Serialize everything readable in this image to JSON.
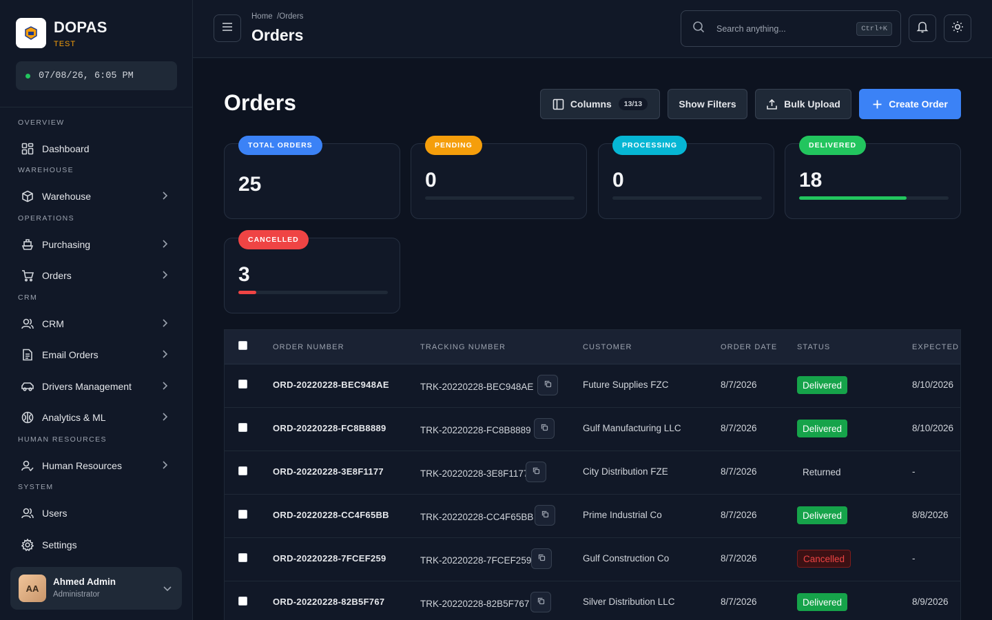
{
  "brand": {
    "name": "DOPAS",
    "env": "TEST"
  },
  "clock": "07/08/26, 6:05 PM",
  "sidebar": {
    "sections": [
      {
        "label": "OVERVIEW",
        "items": [
          {
            "label": "Dashboard",
            "icon": "dashboard-icon",
            "chevron": false
          }
        ]
      },
      {
        "label": "WAREHOUSE",
        "items": [
          {
            "label": "Warehouse",
            "icon": "box-icon",
            "chevron": true
          }
        ]
      },
      {
        "label": "OPERATIONS",
        "items": [
          {
            "label": "Purchasing",
            "icon": "ship-icon",
            "chevron": true
          },
          {
            "label": "Orders",
            "icon": "cart-icon",
            "chevron": true
          }
        ]
      },
      {
        "label": "CRM",
        "items": [
          {
            "label": "CRM",
            "icon": "users-icon",
            "chevron": true
          },
          {
            "label": "Email Orders",
            "icon": "document-icon",
            "chevron": true
          },
          {
            "label": "Drivers Management",
            "icon": "car-icon",
            "chevron": true
          },
          {
            "label": "Analytics & ML",
            "icon": "brain-icon",
            "chevron": true
          }
        ]
      },
      {
        "label": "HUMAN RESOURCES",
        "items": [
          {
            "label": "Human Resources",
            "icon": "user-check-icon",
            "chevron": true
          }
        ]
      },
      {
        "label": "SYSTEM",
        "items": [
          {
            "label": "Users",
            "icon": "user-icon",
            "chevron": false
          },
          {
            "label": "Settings",
            "icon": "gear-icon",
            "chevron": false
          }
        ]
      }
    ]
  },
  "user": {
    "initials": "AA",
    "name": "Ahmed Admin",
    "role": "Administrator"
  },
  "header": {
    "breadcrumb": "Home  /Orders",
    "title": "Orders",
    "search_placeholder": "Search anything...",
    "search_shortcut": "Ctrl+K"
  },
  "page": {
    "title": "Orders",
    "buttons": {
      "columns": "Columns",
      "columns_count": "13/13",
      "filters": "Show Filters",
      "bulk": "Bulk Upload",
      "create": "Create Order"
    }
  },
  "stats": [
    {
      "label": "TOTAL ORDERS",
      "value": "25",
      "color": "#3b82f6",
      "progress": null
    },
    {
      "label": "PENDING",
      "value": "0",
      "color": "#f59e0b",
      "progress": 0
    },
    {
      "label": "PROCESSING",
      "value": "0",
      "color": "#06b6d4",
      "progress": 0
    },
    {
      "label": "DELIVERED",
      "value": "18",
      "color": "#22c55e",
      "progress": 0.72
    },
    {
      "label": "CANCELLED",
      "value": "3",
      "color": "#ef4444",
      "progress": 0.12
    }
  ],
  "table": {
    "headers": [
      "ORDER NUMBER",
      "TRACKING NUMBER",
      "CUSTOMER",
      "ORDER DATE",
      "STATUS",
      "EXPECTED D"
    ],
    "rows": [
      {
        "order": "ORD-20220228-BEC948AE",
        "tracking": "TRK-20220228-BEC948AE",
        "customer": "Future Supplies FZC",
        "date": "8/7/2026",
        "status": "Delivered",
        "expected": "8/10/2026"
      },
      {
        "order": "ORD-20220228-FC8B8889",
        "tracking": "TRK-20220228-FC8B8889",
        "customer": "Gulf Manufacturing LLC",
        "date": "8/7/2026",
        "status": "Delivered",
        "expected": "8/10/2026"
      },
      {
        "order": "ORD-20220228-3E8F1177",
        "tracking": "TRK-20220228-3E8F1177",
        "customer": "City Distribution FZE",
        "date": "8/7/2026",
        "status": "Returned",
        "expected": "-"
      },
      {
        "order": "ORD-20220228-CC4F65BB",
        "tracking": "TRK-20220228-CC4F65BB",
        "customer": "Prime Industrial Co",
        "date": "8/7/2026",
        "status": "Delivered",
        "expected": "8/8/2026"
      },
      {
        "order": "ORD-20220228-7FCEF259",
        "tracking": "TRK-20220228-7FCEF259",
        "customer": "Gulf Construction Co",
        "date": "8/7/2026",
        "status": "Cancelled",
        "expected": "-"
      },
      {
        "order": "ORD-20220228-82B5F767",
        "tracking": "TRK-20220228-82B5F767",
        "customer": "Silver Distribution LLC",
        "date": "8/7/2026",
        "status": "Delivered",
        "expected": "8/9/2026"
      }
    ]
  }
}
